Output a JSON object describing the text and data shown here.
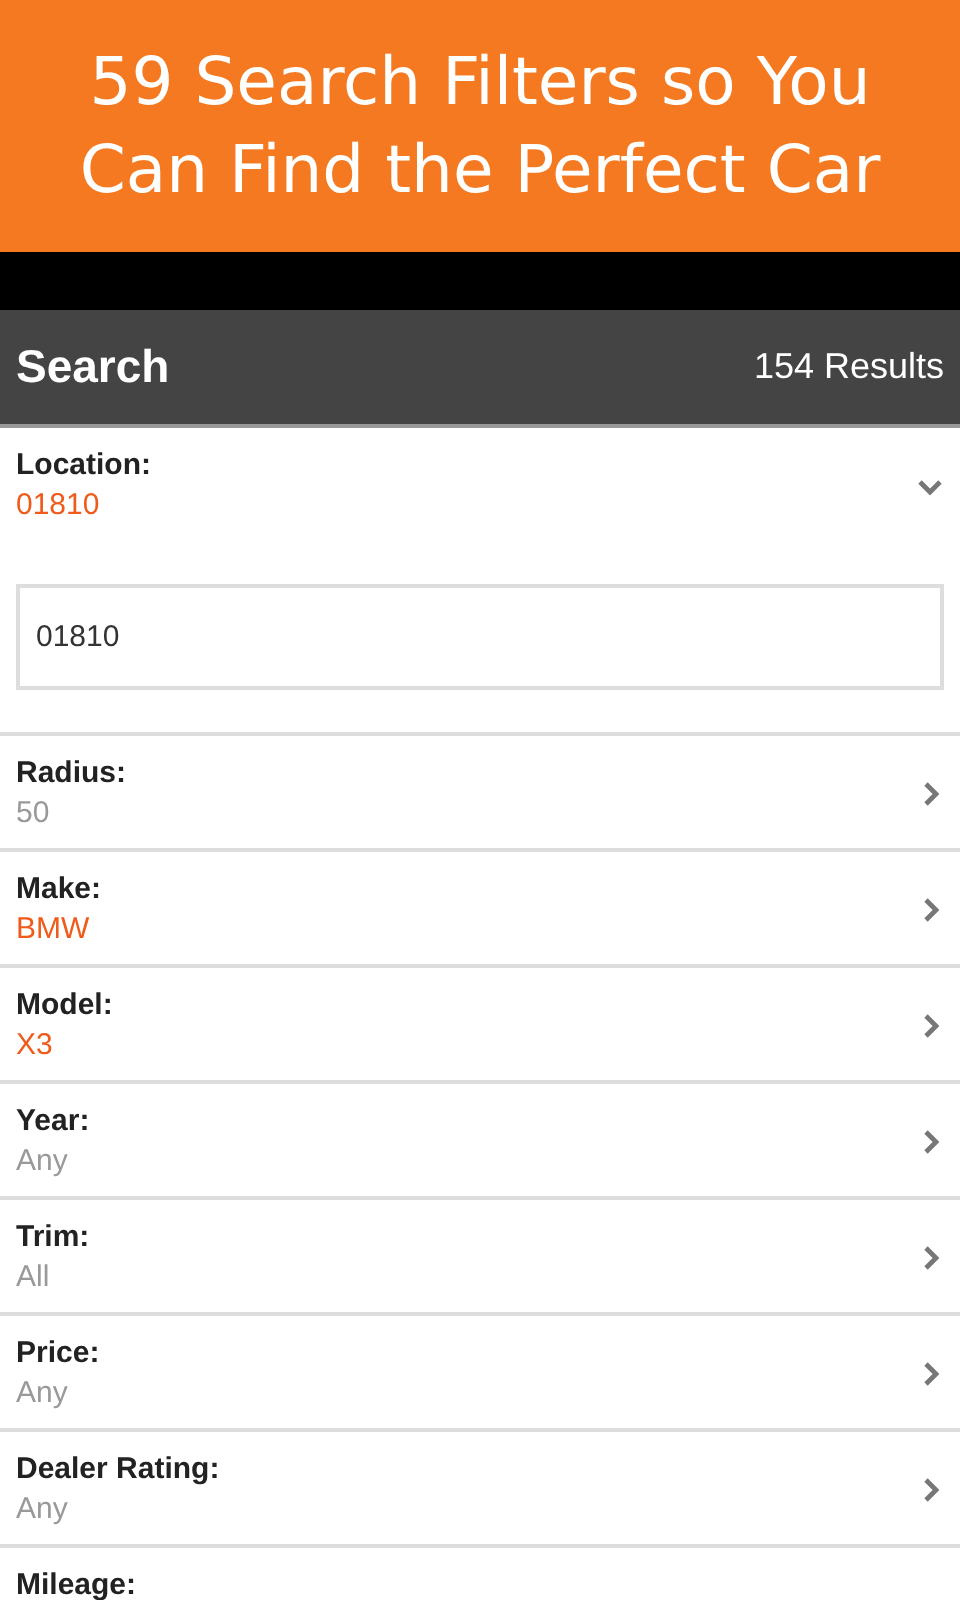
{
  "banner": {
    "headline": "59 Search Filters so You Can Find the Perfect Car"
  },
  "header": {
    "title": "Search",
    "results": "154 Results"
  },
  "filters": [
    {
      "label": "Location:",
      "value": "01810",
      "set": true,
      "expanded": true,
      "input_value": "01810"
    },
    {
      "label": "Radius:",
      "value": "50",
      "set": false,
      "expanded": false
    },
    {
      "label": "Make:",
      "value": "BMW",
      "set": true,
      "expanded": false
    },
    {
      "label": "Model:",
      "value": "X3",
      "set": true,
      "expanded": false
    },
    {
      "label": "Year:",
      "value": "Any",
      "set": false,
      "expanded": false
    },
    {
      "label": "Trim:",
      "value": "All",
      "set": false,
      "expanded": false
    },
    {
      "label": "Price:",
      "value": "Any",
      "set": false,
      "expanded": false
    },
    {
      "label": "Dealer Rating:",
      "value": "Any",
      "set": false,
      "expanded": false
    },
    {
      "label": "Mileage:"
    }
  ]
}
